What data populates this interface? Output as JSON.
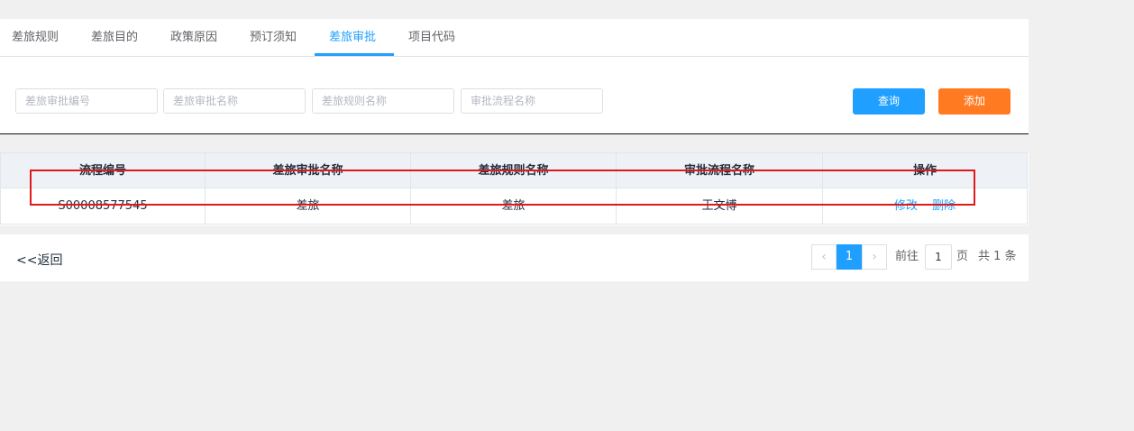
{
  "tabs": [
    {
      "label": "差旅规则"
    },
    {
      "label": "差旅目的"
    },
    {
      "label": "政策原因"
    },
    {
      "label": "预订须知"
    },
    {
      "label": "差旅审批"
    },
    {
      "label": "项目代码"
    }
  ],
  "active_tab": "差旅审批",
  "filters": {
    "approval_code_placeholder": "差旅审批编号",
    "approval_name_placeholder": "差旅审批名称",
    "rule_name_placeholder": "差旅规则名称",
    "flow_name_placeholder": "审批流程名称"
  },
  "buttons": {
    "search_label": "查询",
    "add_label": "添加"
  },
  "colors": {
    "primary": "#1f9fff",
    "add": "#ff7a21",
    "highlight": "#e01a1a"
  },
  "table": {
    "headers": [
      "流程编号",
      "差旅审批名称",
      "差旅规则名称",
      "审批流程名称",
      "操作"
    ],
    "rows": [
      {
        "code": "S00008577545",
        "approval_name": "差旅",
        "rule_name": "差旅",
        "flow_name": "王文博",
        "edit_label": "修改",
        "delete_label": "删除"
      }
    ]
  },
  "back_label": "<<返回",
  "pagination": {
    "prev_icon": "‹",
    "next_icon": "›",
    "current_page": "1",
    "goto_label": "前往",
    "goto_value": "1",
    "page_suffix": "页",
    "total_label": "共 1 条"
  }
}
